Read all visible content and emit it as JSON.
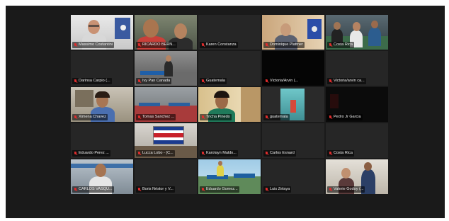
{
  "meeting": {
    "participants": [
      {
        "name": "Massimo Costantini",
        "muted": true,
        "active": true,
        "video": "man-glasses-office"
      },
      {
        "name": "RICARDO BERN...",
        "muted": true,
        "video": "two-men"
      },
      {
        "name": "Karen Constanza",
        "muted": true,
        "video": "off"
      },
      {
        "name": "Dominique Plattner",
        "muted": true,
        "video": "man-office-flag"
      },
      {
        "name": "Costa Rica",
        "muted": true,
        "video": "group-gym"
      },
      {
        "name": "Darinsa Carpio (...",
        "muted": true,
        "video": "off"
      },
      {
        "name": "Ivy Pan Canada",
        "muted": true,
        "video": "table-room"
      },
      {
        "name": "Guatemala",
        "muted": true,
        "video": "off"
      },
      {
        "name": "Victoria/Arvin (...",
        "muted": true,
        "video": "dark"
      },
      {
        "name": "Victoria/arvin ca...",
        "muted": true,
        "video": "off"
      },
      {
        "name": "Ximena Chavez",
        "muted": true,
        "video": "girl-room"
      },
      {
        "name": "Tomas Sanchez ...",
        "muted": true,
        "video": "hall-tables"
      },
      {
        "name": "Tricha Pinedo",
        "muted": true,
        "video": "woman-window"
      },
      {
        "name": "guatemala",
        "muted": true,
        "video": "aqua-room"
      },
      {
        "name": "Pedro Jr Garcia",
        "muted": true,
        "video": "dark-red"
      },
      {
        "name": "Eduardo Perez ...",
        "muted": true,
        "video": "off"
      },
      {
        "name": "Lucca Lobo - (C...",
        "muted": true,
        "video": "flag-room"
      },
      {
        "name": "Karolayn Maldo...",
        "muted": true,
        "video": "off"
      },
      {
        "name": "Carlos Esnard",
        "muted": true,
        "video": "off"
      },
      {
        "name": "Costa Rica",
        "muted": true,
        "video": "off"
      },
      {
        "name": "CARLOS VASQU...",
        "muted": true,
        "video": "man-blue"
      },
      {
        "name": "Boris Néstor y V...",
        "muted": true,
        "video": "off"
      },
      {
        "name": "Eduardo Gomez...",
        "muted": true,
        "video": "outdoor-tables"
      },
      {
        "name": "Luis Zelaya",
        "muted": true,
        "video": "off"
      },
      {
        "name": "Valerie Godoy (...",
        "muted": true,
        "video": "woman-dark"
      }
    ]
  },
  "icons": {
    "muted": "mic-off-icon"
  },
  "colors": {
    "active_outline": "#d8ff2f",
    "mic_off": "#e02d2d",
    "tile_bg": "#262626",
    "window_bg": "#1a1a1a"
  }
}
